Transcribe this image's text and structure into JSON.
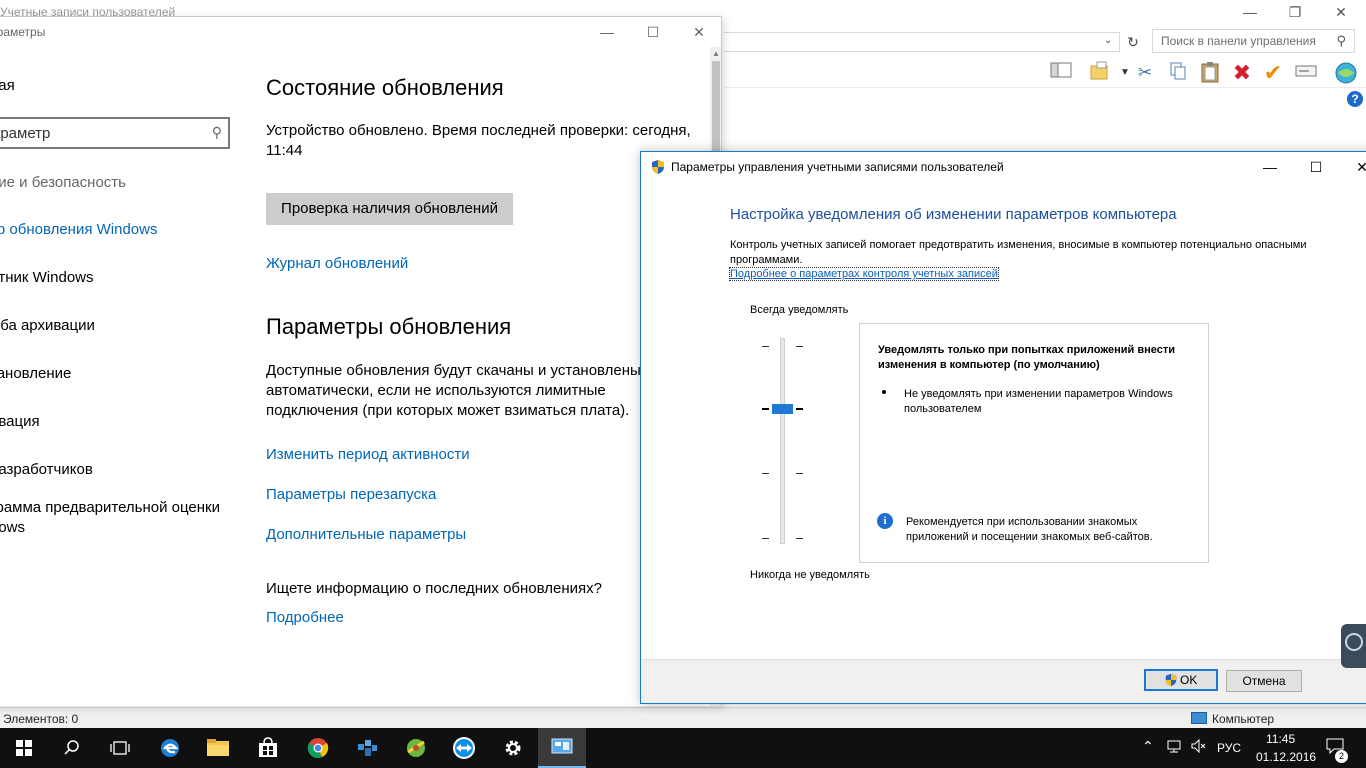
{
  "control_panel": {
    "title": "Учетные записи пользователей",
    "search_placeholder": "Поиск в панели управления",
    "status_items": "Элементов: 0",
    "status_location": "Компьютер",
    "colors": {
      "help": "#1e69c9",
      "delete": "#d4202a",
      "check": "#f08a00"
    }
  },
  "settings": {
    "title": "араметры",
    "nav_home": "ная",
    "search_value": "араметр",
    "nav_category": "ние и безопасность",
    "nav_items": [
      {
        "label": "тр обновления Windows",
        "active": true
      },
      {
        "label": "итник Windows",
        "active": false
      },
      {
        "label": "жба архивации",
        "active": false
      },
      {
        "label": "тановление",
        "active": false
      },
      {
        "label": "ивация",
        "active": false
      },
      {
        "label": "разработчиков",
        "active": false
      },
      {
        "label": "грамма предварительной оценки",
        "active": false
      },
      {
        "label": "dows",
        "active": false
      }
    ],
    "update_status_heading": "Состояние обновления",
    "update_status_text_1": "Устройство обновлено. Время последней проверки: сегодня,",
    "update_status_text_2": "11:44",
    "check_button": "Проверка наличия обновлений",
    "history_link": "Журнал обновлений",
    "update_settings_heading": "Параметры обновления",
    "update_settings_text": "Доступные обновления будут скачаны и установлены автоматически, если не используются лимитные подключения (при которых может взиматься плата).",
    "links": [
      "Изменить период активности",
      "Параметры перезапуска",
      "Дополнительные параметры"
    ],
    "info_question": "Ищете информацию о последних обновлениях?",
    "more_link": "Подробнее",
    "accent": "#0067b8"
  },
  "uac": {
    "title": "Параметры управления учетными записями пользователей",
    "heading": "Настройка уведомления об изменении параметров компьютера",
    "description": "Контроль учетных записей помогает предотвратить изменения, вносимые в компьютер потенциально опасными программами.",
    "learn_more": "Подробнее о параметрах контроля учетных записей",
    "always_label": "Всегда уведомлять",
    "never_label": "Никогда не уведомлять",
    "slider_level": 3,
    "slider_levels": 4,
    "info_title": "Уведомлять только при попытках приложений внести изменения в компьютер (по умолчанию)",
    "bullet": "Не уведомлять при изменении параметров Windows пользователем",
    "recommendation": "Рекомендуется при использовании знакомых приложений и посещении знакомых веб-сайтов.",
    "ok_label": "OK",
    "cancel_label": "Отмена",
    "heading_color": "#1e4f9e"
  },
  "taskbar": {
    "apps": [
      {
        "name": "start",
        "icon": "windows-logo"
      },
      {
        "name": "search",
        "icon": "search-icon"
      },
      {
        "name": "task-view",
        "icon": "task-view-icon"
      },
      {
        "name": "edge",
        "icon": "edge-icon"
      },
      {
        "name": "explorer",
        "icon": "folder-icon"
      },
      {
        "name": "store",
        "icon": "store-icon"
      },
      {
        "name": "chrome",
        "icon": "chrome-icon"
      },
      {
        "name": "app-blue",
        "icon": "app-icon"
      },
      {
        "name": "app-green",
        "icon": "app-icon"
      },
      {
        "name": "teamviewer",
        "icon": "teamviewer-icon"
      },
      {
        "name": "settings",
        "icon": "gear-icon"
      },
      {
        "name": "control-panel",
        "icon": "control-panel-icon"
      }
    ],
    "language": "РУС",
    "time": "11:45",
    "date": "01.12.2016",
    "notification_count": "2"
  }
}
